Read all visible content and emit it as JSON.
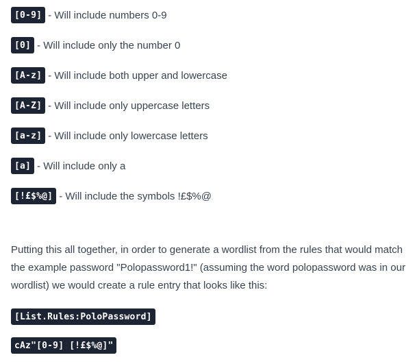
{
  "rules": [
    {
      "code": "[0-9]",
      "sep": "-",
      "description": "Will include numbers 0-9"
    },
    {
      "code": "[0]",
      "sep": "-",
      "description": "Will include only the number 0"
    },
    {
      "code": "[A-z]",
      "sep": "-",
      "description": "Will include both upper and lowercase"
    },
    {
      "code": "[A-Z]",
      "sep": "-",
      "description": "Will include only uppercase letters"
    },
    {
      "code": "[a-z]",
      "sep": "-",
      "description": "Will include only lowercase letters"
    },
    {
      "code": "[a]",
      "sep": "-",
      "description": "Will include only a"
    },
    {
      "code": "[!£$%@]",
      "sep": "-",
      "description": "Will include the symbols !£$%@"
    }
  ],
  "explanation": "Putting this all together, in order to generate a wordlist from the rules that would match the example password \"Polopassword1!\" (assuming the word polopassword was in our wordlist) we would create a rule entry that looks like this:",
  "code_blocks": {
    "header": "[List.Rules:PoloPassword]",
    "entry": "cAz\"[0-9] [!£$%@]\""
  },
  "colors": {
    "code_background": "#1d2433",
    "code_text": "#ffffff",
    "body_text": "#3a4350",
    "page_background": "#ffffff"
  }
}
